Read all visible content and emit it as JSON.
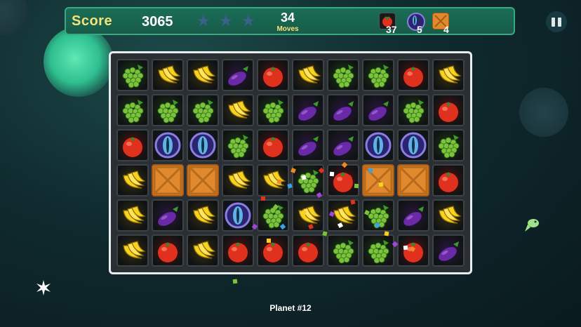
{
  "hud": {
    "score_label": "Score",
    "score_value": "3065",
    "stars_earned": 0,
    "stars_total": 3,
    "moves_value": "34",
    "moves_label": "Moves",
    "goals": [
      {
        "icon": "tomato-icon",
        "count": "37"
      },
      {
        "icon": "eye-orb-icon",
        "count": "5"
      },
      {
        "icon": "crate-icon",
        "count": "4"
      }
    ]
  },
  "level": {
    "name": "Planet #12"
  },
  "board": {
    "rows": 6,
    "cols": 10,
    "grid": [
      [
        "grape",
        "banana",
        "banana",
        "eggplant",
        "tomato",
        "banana",
        "grape",
        "grape",
        "tomato",
        "banana"
      ],
      [
        "grape",
        "grape",
        "grape",
        "banana",
        "grape",
        "eggplant",
        "eggplant",
        "eggplant",
        "grape",
        "tomato"
      ],
      [
        "tomato",
        "orb",
        "orb",
        "grape",
        "tomato",
        "eggplant",
        "eggplant",
        "orb",
        "orb",
        "grape"
      ],
      [
        "banana",
        "crate",
        "crate",
        "banana",
        "banana",
        "grape",
        "tomato",
        "crate",
        "crate",
        "tomato"
      ],
      [
        "banana",
        "eggplant",
        "banana",
        "orb",
        "grape",
        "banana",
        "banana",
        "grape",
        "eggplant",
        "banana"
      ],
      [
        "banana",
        "tomato",
        "banana",
        "tomato",
        "tomato",
        "tomato",
        "grape",
        "grape",
        "tomato",
        "eggplant"
      ]
    ]
  },
  "colors": {
    "accent": "#f6e27a",
    "hud_bg": "#1b6d55",
    "board_border": "#e9ecee",
    "tomato": "#e0301e",
    "banana": "#f7d21f",
    "grape": "#7cc23a",
    "eggplant": "#6a2aa8",
    "orb": "#4a3db3",
    "crate": "#e08a2d"
  }
}
